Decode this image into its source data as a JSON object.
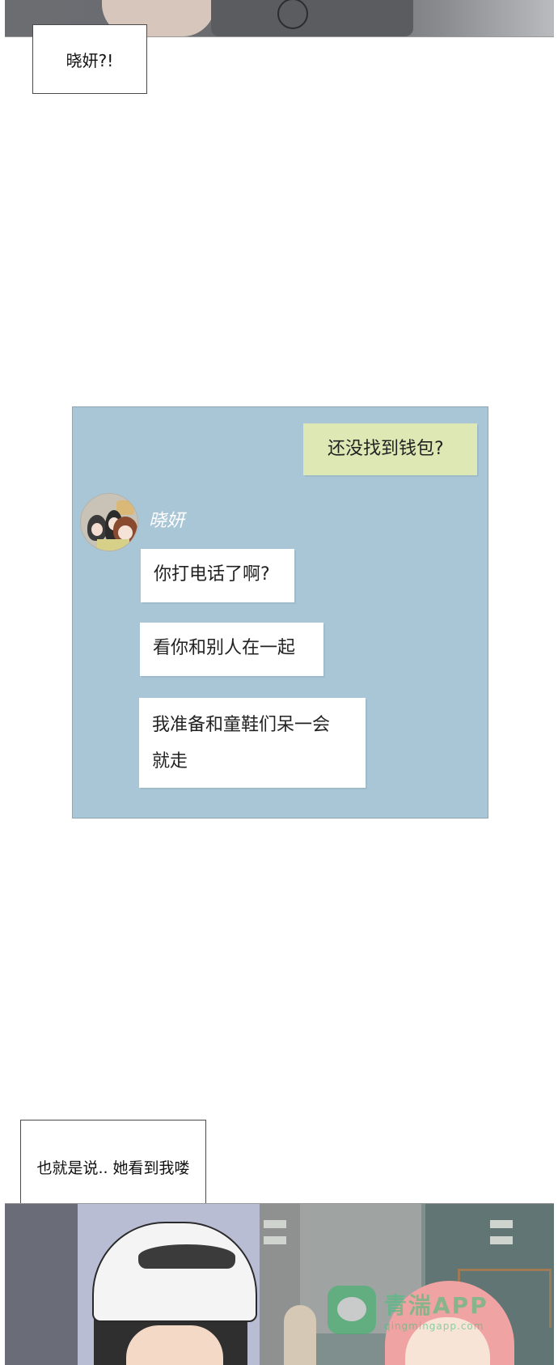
{
  "panel_top": {
    "narration": "晓妍?!"
  },
  "chat": {
    "sent_message": "还没找到钱包?",
    "contact_name": "晓妍",
    "received_messages": [
      "你打电话了啊?",
      "看你和别人在一起",
      "我准备和童鞋们呆一会",
      "就走"
    ],
    "colors": {
      "background": "#a9c6d6",
      "sent_bubble": "#dde8b4",
      "received_bubble": "#ffffff"
    }
  },
  "panel_bottom": {
    "narration": "也就是说.. 她看到我喽"
  },
  "watermark": {
    "main": "青湍APP",
    "sub": "qingmingapp.com"
  }
}
